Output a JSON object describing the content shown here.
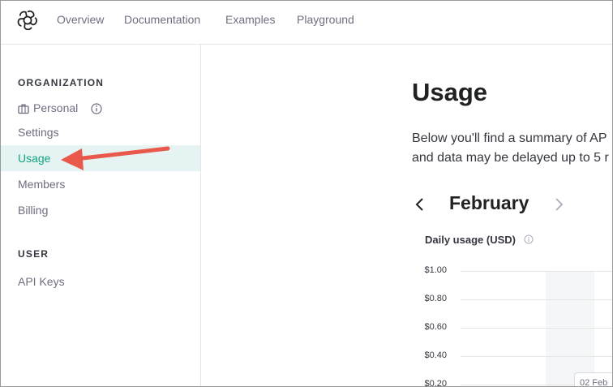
{
  "nav": {
    "links": [
      "Overview",
      "Documentation",
      "Examples",
      "Playground"
    ]
  },
  "sidebar": {
    "org_section": "ORGANIZATION",
    "org_name": "Personal",
    "items": [
      "Settings",
      "Usage",
      "Members",
      "Billing"
    ],
    "active": "Usage",
    "user_section": "USER",
    "user_items": [
      "API Keys"
    ]
  },
  "main": {
    "title": "Usage",
    "description_line1": "Below you'll find a summary of AP",
    "description_line2": "and data may be delayed up to 5 r",
    "month": "February",
    "chart_title": "Daily usage (USD)",
    "tooltip": "02 Feb"
  },
  "chart_data": {
    "type": "bar",
    "title": "Daily usage (USD)",
    "yticks": [
      "$1.00",
      "$0.80",
      "$0.60",
      "$0.40",
      "$0.20"
    ],
    "ylim": [
      0,
      1
    ],
    "grid": true
  },
  "colors": {
    "accent": "#10a37f",
    "active_bg": "#e6f3f3",
    "arrow": "#e8594b"
  }
}
